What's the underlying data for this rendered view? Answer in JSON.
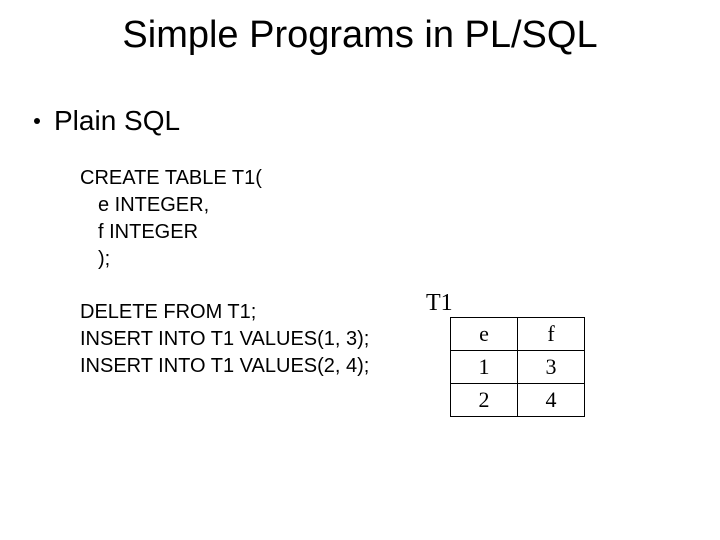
{
  "title": "Simple Programs in PL/SQL",
  "bullet": "Plain SQL",
  "code1": {
    "l1": "CREATE TABLE T1(",
    "l2": "e INTEGER,",
    "l3": "f  INTEGER",
    "l4": ");"
  },
  "code2": {
    "l1": "DELETE FROM T1;",
    "l2": "INSERT INTO T1 VALUES(1, 3);",
    "l3": "INSERT INTO T1 VALUES(2, 4);"
  },
  "table": {
    "name": "T1",
    "h1": "e",
    "h2": "f",
    "r1c1": "1",
    "r1c2": "3",
    "r2c1": "2",
    "r2c2": "4"
  }
}
